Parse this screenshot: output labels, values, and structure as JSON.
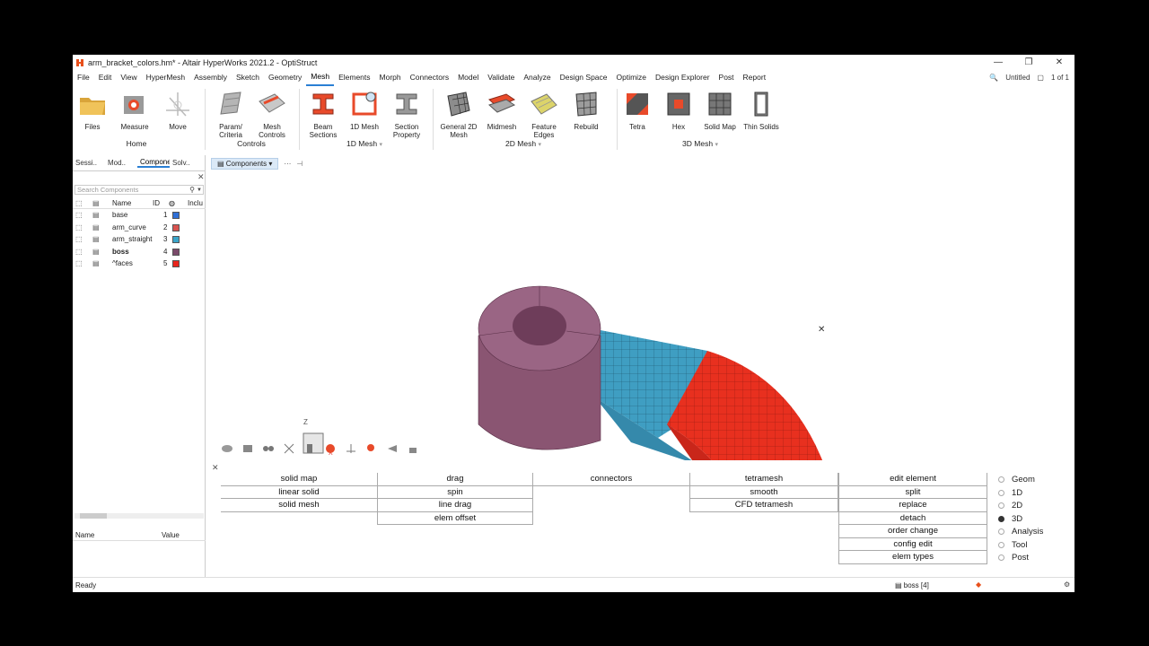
{
  "window": {
    "title": "arm_bracket_colors.hm* - Altair HyperWorks 2021.2 - OptiStruct"
  },
  "menu": [
    "File",
    "Edit",
    "View",
    "HyperMesh",
    "Assembly",
    "Sketch",
    "Geometry",
    "Mesh",
    "Elements",
    "Morph",
    "Connectors",
    "Model",
    "Validate",
    "Analyze",
    "Design Space",
    "Optimize",
    "Design Explorer",
    "Post",
    "Report"
  ],
  "menu_active": "Mesh",
  "menu_right": {
    "session": "Untitled",
    "pages": "1 of 1"
  },
  "ribbon": {
    "tools": [
      {
        "label1": "Files",
        "label2": ""
      },
      {
        "label1": "Measure",
        "label2": ""
      },
      {
        "label1": "Move",
        "label2": ""
      },
      {
        "label1": "Param/",
        "label2": "Criteria"
      },
      {
        "label1": "Mesh",
        "label2": "Controls"
      },
      {
        "label1": "Beam",
        "label2": "Sections"
      },
      {
        "label1": "1D Mesh",
        "label2": ""
      },
      {
        "label1": "Section",
        "label2": "Property"
      },
      {
        "label1": "General 2D",
        "label2": "Mesh"
      },
      {
        "label1": "Midmesh",
        "label2": ""
      },
      {
        "label1": "Feature",
        "label2": "Edges"
      },
      {
        "label1": "Rebuild",
        "label2": ""
      },
      {
        "label1": "Tetra",
        "label2": ""
      },
      {
        "label1": "Hex",
        "label2": ""
      },
      {
        "label1": "Solid Map",
        "label2": ""
      },
      {
        "label1": "Thin Solids",
        "label2": ""
      }
    ],
    "groups": [
      "Home",
      "Controls",
      "1D Mesh",
      "2D Mesh",
      "3D Mesh"
    ]
  },
  "panel_tabs": [
    "Sessi..",
    "Mod..",
    "Componen..",
    "Solv.."
  ],
  "search_placeholder": "Search Components",
  "components": {
    "headers": {
      "name": "Name",
      "id": "ID",
      "include": "Inclu"
    },
    "rows": [
      {
        "name": "base",
        "id": "1",
        "color": "#2f6fd6"
      },
      {
        "name": "arm_curve",
        "id": "2",
        "color": "#d9534f"
      },
      {
        "name": "arm_straight",
        "id": "3",
        "color": "#3aa5c9"
      },
      {
        "name": "boss",
        "id": "4",
        "color": "#7a4a6a"
      },
      {
        "name": "^faces",
        "id": "5",
        "color": "#e8241c"
      }
    ]
  },
  "properties": {
    "name": "Name",
    "value": "Value"
  },
  "viewport": {
    "entity_selector": "Components"
  },
  "panels": {
    "col1": [
      "solid map",
      "linear solid",
      "solid mesh"
    ],
    "col2": [
      "drag",
      "spin",
      "line drag",
      "elem offset"
    ],
    "col3": [
      "connectors"
    ],
    "col4": [
      "tetramesh",
      "smooth",
      "CFD tetramesh"
    ],
    "col5": [
      "edit element",
      "split",
      "replace",
      "detach",
      "order change",
      "config edit",
      "elem types"
    ],
    "radios": [
      "Geom",
      "1D",
      "2D",
      "3D",
      "Analysis",
      "Tool",
      "Post"
    ],
    "radio_selected": "3D"
  },
  "status": {
    "text": "Ready",
    "component": "boss [4]"
  },
  "colors": {
    "boss": "#8a5572",
    "arm_straight": "#3f9ec2",
    "arm_curve": "#e8301f",
    "accent": "#2a7fd4"
  }
}
